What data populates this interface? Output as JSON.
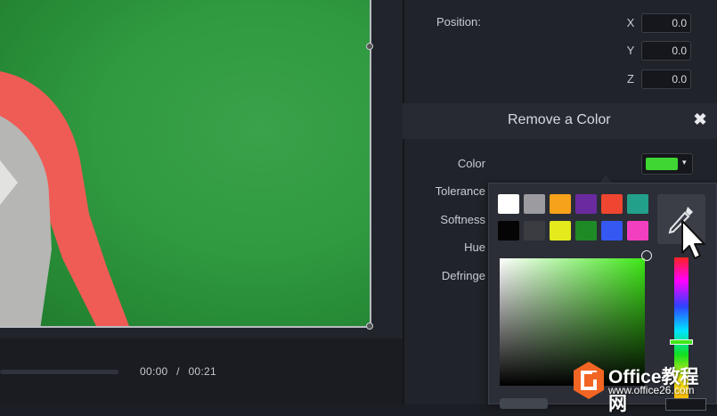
{
  "transform": {
    "position_label": "Position:",
    "x_label": "X",
    "x_value": "0.0",
    "y_label": "Y",
    "y_value": "0.0",
    "z_label": "Z",
    "z_value": "0.0"
  },
  "effect": {
    "title": "Remove a Color",
    "close_glyph": "✖",
    "color_label": "Color",
    "tolerance_label": "Tolerance",
    "softness_label": "Softness",
    "hue_label": "Hue",
    "defringe_label": "Defringe",
    "selected_color": "#3fd634",
    "caret": "▾"
  },
  "color_picker": {
    "swatches": [
      "#ffffff",
      "#9b9ba0",
      "#f7a21b",
      "#6a2aa0",
      "#f04530",
      "#23a08a",
      "#050505",
      "#3a3c42",
      "#e4eb1c",
      "#1e8a26",
      "#3558f2",
      "#f23fc0"
    ],
    "eyedropper_icon": "eyedropper-icon",
    "hue_color": "#3ee817"
  },
  "playback": {
    "current_time": "00:00",
    "separator": "/",
    "total_time": "00:21"
  },
  "watermark": {
    "line1": "Office教程网",
    "line2": "www.office26.com",
    "brand_color": "#f26522"
  }
}
